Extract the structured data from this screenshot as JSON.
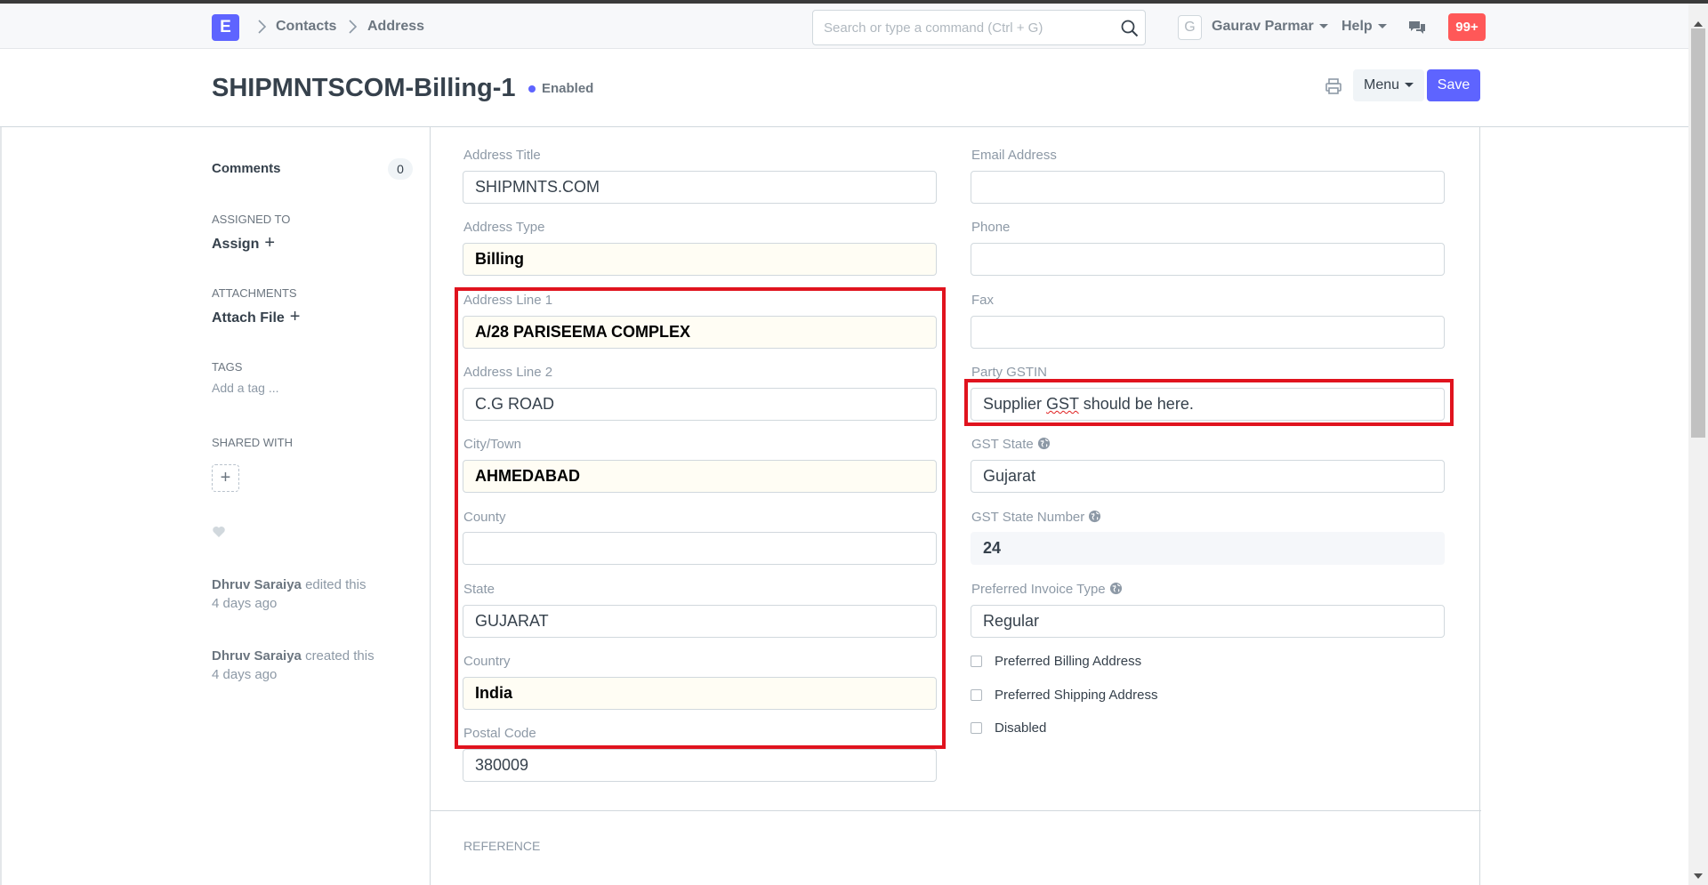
{
  "navbar": {
    "logo_letter": "E",
    "breadcrumbs": [
      "Contacts",
      "Address"
    ],
    "search_placeholder": "Search or type a command (Ctrl + G)",
    "avatar_letter": "G",
    "user_name": "Gaurav Parmar",
    "help_label": "Help",
    "notification_count": "99+"
  },
  "page": {
    "title": "SHIPMNTSCOM-Billing-1",
    "status": "Enabled",
    "menu_label": "Menu",
    "save_label": "Save"
  },
  "sidebar": {
    "comments_label": "Comments",
    "comments_count": "0",
    "assigned_to_label": "ASSIGNED TO",
    "assign_label": "Assign",
    "attachments_label": "ATTACHMENTS",
    "attach_label": "Attach File",
    "tags_label": "TAGS",
    "add_tag_label": "Add a tag ...",
    "shared_with_label": "SHARED WITH",
    "timeline": [
      {
        "user": "Dhruv Saraiya",
        "action": "edited this",
        "time": "4 days ago"
      },
      {
        "user": "Dhruv Saraiya",
        "action": "created this",
        "time": "4 days ago"
      }
    ]
  },
  "form": {
    "left": {
      "address_title": {
        "label": "Address Title",
        "value": "SHIPMNTS.COM"
      },
      "address_type": {
        "label": "Address Type",
        "value": "Billing"
      },
      "address_line1": {
        "label": "Address Line 1",
        "value": "A/28 PARISEEMA COMPLEX"
      },
      "address_line2": {
        "label": "Address Line 2",
        "value": "C.G ROAD"
      },
      "city": {
        "label": "City/Town",
        "value": "AHMEDABAD"
      },
      "county": {
        "label": "County",
        "value": ""
      },
      "state": {
        "label": "State",
        "value": "GUJARAT"
      },
      "country": {
        "label": "Country",
        "value": "India"
      },
      "postal_code": {
        "label": "Postal Code",
        "value": "380009"
      }
    },
    "right": {
      "email": {
        "label": "Email Address",
        "value": ""
      },
      "phone": {
        "label": "Phone",
        "value": ""
      },
      "fax": {
        "label": "Fax",
        "value": ""
      },
      "party_gstin": {
        "label": "Party GSTIN",
        "value_pre": "Supplier ",
        "value_err": "GST",
        "value_post": " should be here."
      },
      "gst_state": {
        "label": "GST State",
        "value": "Gujarat"
      },
      "gst_state_number": {
        "label": "GST State Number",
        "value": "24"
      },
      "preferred_invoice_type": {
        "label": "Preferred Invoice Type",
        "value": "Regular"
      },
      "checkboxes": [
        {
          "label": "Preferred Billing Address",
          "checked": false
        },
        {
          "label": "Preferred Shipping Address",
          "checked": false
        },
        {
          "label": "Disabled",
          "checked": false
        }
      ]
    },
    "section_reference": "REFERENCE"
  },
  "colors": {
    "accent": "#5e64ff",
    "notification": "#ff5858",
    "highlight": "#e0131e",
    "required_bg": "#fffdf4"
  }
}
